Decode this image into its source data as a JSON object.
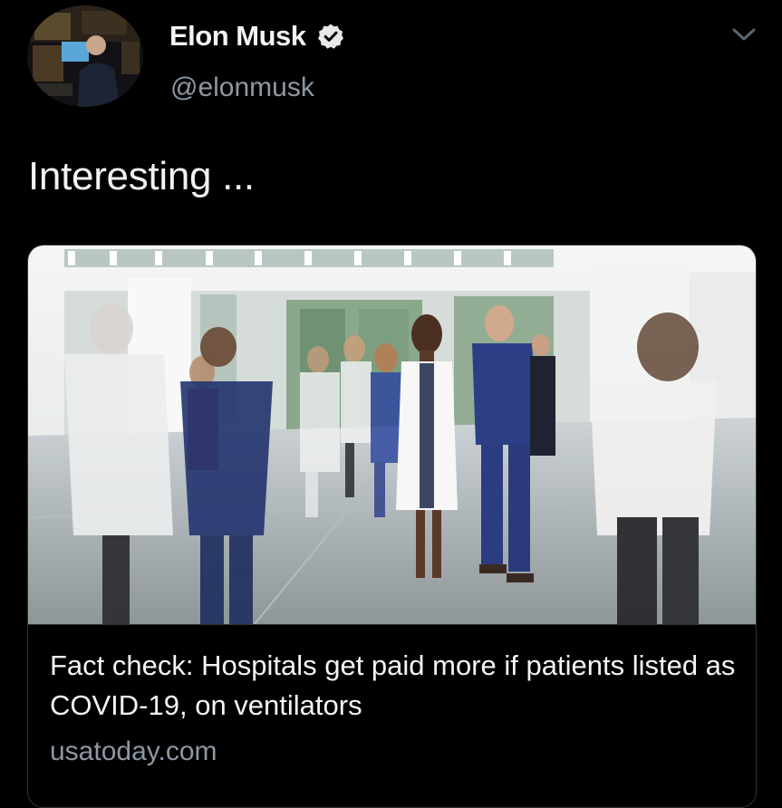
{
  "tweet": {
    "author": {
      "name": "Elon Musk",
      "handle": "@elonmusk",
      "verified": true,
      "avatar_icon": "profile-photo",
      "verified_icon": "verified-badge-icon"
    },
    "menu_icon": "chevron-down-icon",
    "text": "Interesting ...",
    "card": {
      "image_icon": "hospital-lobby-photo",
      "title": "Fact check: Hospitals get paid more if patients listed as COVID-19, on ventilators",
      "domain": "usatoday.com"
    }
  },
  "colors": {
    "background": "#000000",
    "primary_text": "#f4f4f4",
    "secondary_text": "#8b98a5",
    "border": "#2f3336"
  }
}
